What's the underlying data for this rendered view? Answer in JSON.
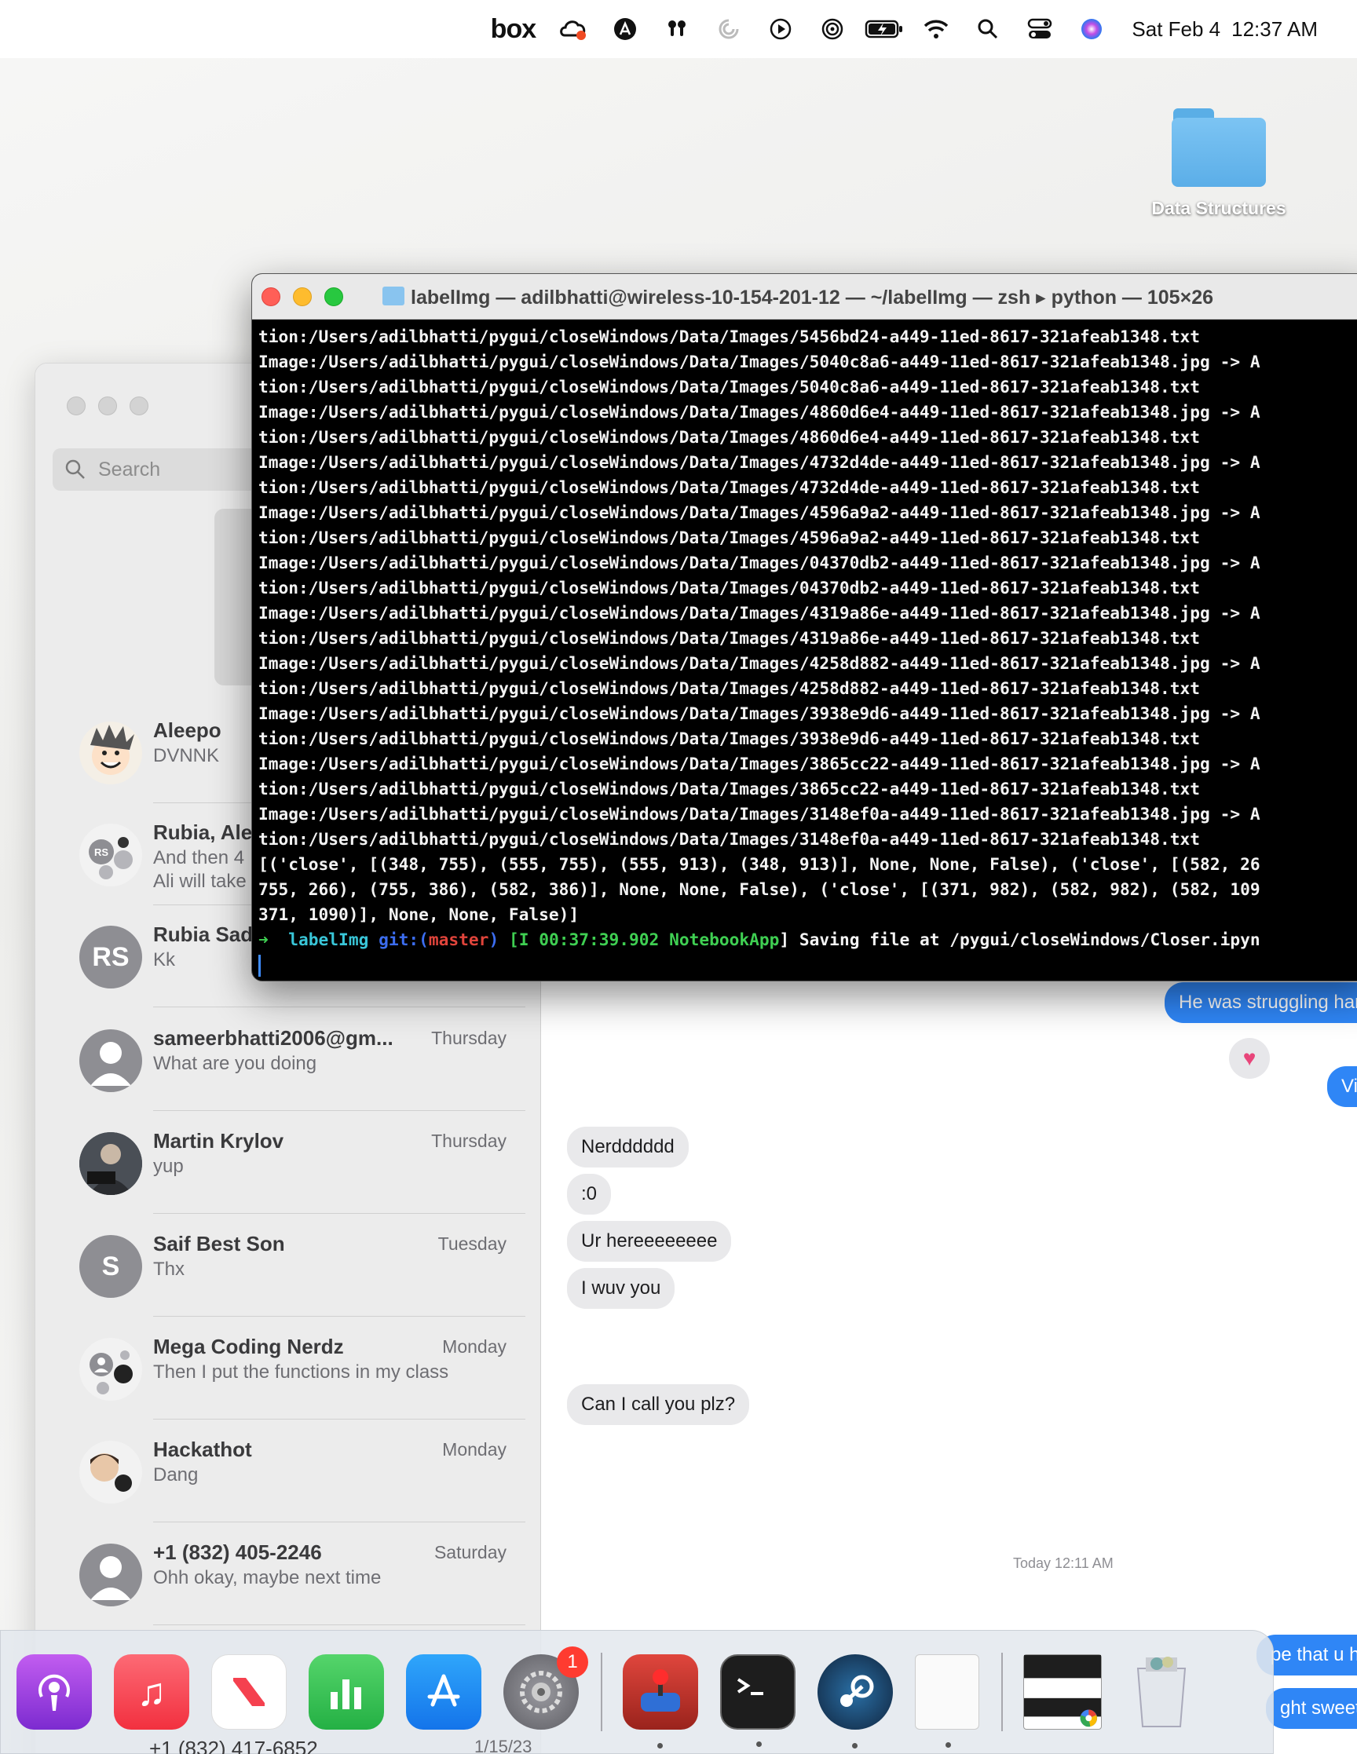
{
  "menubar": {
    "box_label": "box",
    "date": "Sat Feb 4",
    "time": "12:37 AM"
  },
  "desktop": {
    "folder_label": "Data Structures"
  },
  "terminal": {
    "title": "labelImg — adilbhatti@wireless-10-154-201-12 — ~/labelImg — zsh ▸ python — 105×26",
    "lines": [
      "tion:/Users/adilbhatti/pygui/closeWindows/Data/Images/5456bd24-a449-11ed-8617-321afeab1348.txt",
      "Image:/Users/adilbhatti/pygui/closeWindows/Data/Images/5040c8a6-a449-11ed-8617-321afeab1348.jpg -> A",
      "tion:/Users/adilbhatti/pygui/closeWindows/Data/Images/5040c8a6-a449-11ed-8617-321afeab1348.txt",
      "Image:/Users/adilbhatti/pygui/closeWindows/Data/Images/4860d6e4-a449-11ed-8617-321afeab1348.jpg -> A",
      "tion:/Users/adilbhatti/pygui/closeWindows/Data/Images/4860d6e4-a449-11ed-8617-321afeab1348.txt",
      "Image:/Users/adilbhatti/pygui/closeWindows/Data/Images/4732d4de-a449-11ed-8617-321afeab1348.jpg -> A",
      "tion:/Users/adilbhatti/pygui/closeWindows/Data/Images/4732d4de-a449-11ed-8617-321afeab1348.txt",
      "Image:/Users/adilbhatti/pygui/closeWindows/Data/Images/4596a9a2-a449-11ed-8617-321afeab1348.jpg -> A",
      "tion:/Users/adilbhatti/pygui/closeWindows/Data/Images/4596a9a2-a449-11ed-8617-321afeab1348.txt",
      "Image:/Users/adilbhatti/pygui/closeWindows/Data/Images/04370db2-a449-11ed-8617-321afeab1348.jpg -> A",
      "tion:/Users/adilbhatti/pygui/closeWindows/Data/Images/04370db2-a449-11ed-8617-321afeab1348.txt",
      "Image:/Users/adilbhatti/pygui/closeWindows/Data/Images/4319a86e-a449-11ed-8617-321afeab1348.jpg -> A",
      "tion:/Users/adilbhatti/pygui/closeWindows/Data/Images/4319a86e-a449-11ed-8617-321afeab1348.txt",
      "Image:/Users/adilbhatti/pygui/closeWindows/Data/Images/4258d882-a449-11ed-8617-321afeab1348.jpg -> A",
      "tion:/Users/adilbhatti/pygui/closeWindows/Data/Images/4258d882-a449-11ed-8617-321afeab1348.txt",
      "Image:/Users/adilbhatti/pygui/closeWindows/Data/Images/3938e9d6-a449-11ed-8617-321afeab1348.jpg -> A",
      "tion:/Users/adilbhatti/pygui/closeWindows/Data/Images/3938e9d6-a449-11ed-8617-321afeab1348.txt",
      "Image:/Users/adilbhatti/pygui/closeWindows/Data/Images/3865cc22-a449-11ed-8617-321afeab1348.jpg -> A",
      "tion:/Users/adilbhatti/pygui/closeWindows/Data/Images/3865cc22-a449-11ed-8617-321afeab1348.txt",
      "Image:/Users/adilbhatti/pygui/closeWindows/Data/Images/3148ef0a-a449-11ed-8617-321afeab1348.jpg -> A",
      "tion:/Users/adilbhatti/pygui/closeWindows/Data/Images/3148ef0a-a449-11ed-8617-321afeab1348.txt",
      "[('close', [(348, 755), (555, 755), (555, 913), (348, 913)], None, None, False), ('close', [(582, 26",
      "755, 266), (755, 386), (582, 386)], None, None, False), ('close', [(371, 982), (582, 982), (582, 109",
      "371, 1090)], None, None, False)]"
    ],
    "prompt": {
      "arrow": "➜",
      "dir": "labelImg",
      "git": "git:(",
      "branch": "master",
      "git_close": ")",
      "bracket_open": "[I 00:37:39.902 ",
      "app": "NotebookApp",
      "message": "] Saving file at /pygui/closeWindows/Closer.ipyn"
    }
  },
  "messages": {
    "search_placeholder": "Search",
    "conversations": [
      {
        "name": "Aleepo",
        "preview": "DVNNK",
        "when": "",
        "avatar": "cartoon"
      },
      {
        "name": "Rubia, Ale",
        "preview": "And then 4",
        "preview2": "Ali will take",
        "when": "",
        "avatar": "RS"
      },
      {
        "name": "Rubia Sad",
        "preview": "Kk",
        "when": "",
        "avatar": "RS"
      },
      {
        "name": "sameerbhatti2006@gm...",
        "preview": "What are you doing",
        "when": "Thursday",
        "avatar": "person"
      },
      {
        "name": "Martin Krylov",
        "preview": "yup",
        "when": "Thursday",
        "avatar": "photo"
      },
      {
        "name": "Saif Best Son",
        "preview": "Thx",
        "when": "Tuesday",
        "avatar": "S"
      },
      {
        "name": "Mega Coding Nerdz",
        "preview": "Then I put the functions in my class",
        "when": "Monday",
        "avatar": "group"
      },
      {
        "name": "Hackathot",
        "preview": "Dang",
        "when": "Monday",
        "avatar": "group2"
      },
      {
        "name": "+1 (832) 405-2246",
        "preview": "Ohh okay, maybe next time",
        "when": "Saturday",
        "avatar": "person"
      }
    ],
    "below_dock_name": "+1 (832) 417-6852",
    "below_dock_date": "1/15/23",
    "chat": {
      "out_1": "He was struggling hard i",
      "out_2": "Virtua",
      "in_1": "Nerdddddd",
      "in_2": ":0",
      "in_3": "Ur hereeeeeeee",
      "in_4": "I wuv you",
      "in_5": "Can I call you plz?",
      "timestamp": "Today 12:11 AM",
      "out_3": "pe that u h",
      "out_4": "ght sweet"
    }
  },
  "dock": {
    "apps": [
      {
        "name": "Podcasts",
        "color": "#9b3fd6"
      },
      {
        "name": "Music",
        "color": "#f5414f"
      },
      {
        "name": "News",
        "color": "#ffffff"
      },
      {
        "name": "Numbers",
        "color": "#34c759"
      },
      {
        "name": "App Store",
        "color": "#1e8cf7"
      },
      {
        "name": "System Settings",
        "color": "#8e8e93",
        "badge": "1"
      },
      {
        "name": "Joystick",
        "color": "#d0342c"
      },
      {
        "name": "Terminal",
        "color": "#1b1b1b"
      },
      {
        "name": "Steam",
        "color": "#1b2838"
      },
      {
        "name": "Document",
        "color": "#fafafa"
      },
      {
        "name": "Chrome Window",
        "color": "#222222"
      },
      {
        "name": "Trash",
        "color": "#d9dde2"
      }
    ]
  },
  "colors": {
    "imessage_blue": "#2f86f6",
    "received_gray": "#e9e9eb",
    "terminal_bg": "#000000",
    "prompt_green": "#3fcf52"
  }
}
